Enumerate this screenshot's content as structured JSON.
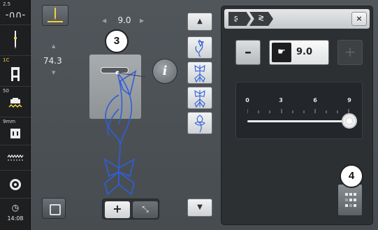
{
  "statusbar": {
    "upper_thread_tension": "2.5",
    "presser_foot_pressure": "1C",
    "stitch_plate": "50",
    "needle_size": "9mm",
    "time": "14:08"
  },
  "stitch": {
    "stitch_width": "74.3",
    "stitch_length": "9.0"
  },
  "callouts": {
    "foot_callout": "3",
    "mirror_callout": "4"
  },
  "buttons": {
    "info_label": "i",
    "zoom_plus_label": "+"
  },
  "panel": {
    "value": "9.0",
    "minus_label": "–",
    "plus_label": "+",
    "close_label": "×",
    "slider": {
      "ticks": [
        "0",
        "3",
        "6",
        "9"
      ],
      "value": 9,
      "min": 0,
      "max": 9
    }
  },
  "colors": {
    "stitch_blue": "#2f5fd8",
    "needle_yellow": "#f5d03a",
    "tension_yellow": "#f2d23c"
  }
}
